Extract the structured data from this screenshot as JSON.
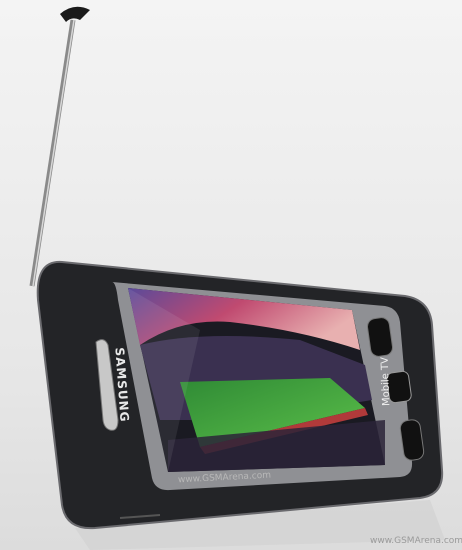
{
  "photo": {
    "subject": "phone",
    "brand_text": "SAMSUNG",
    "screen_label": "Mobile TV",
    "screen_watermark": "www.GSMArena.com",
    "corner_watermark": "www.GSMArena.com",
    "colors": {
      "background": "#ececec",
      "body": "#2a2b2e",
      "bezel": "#9a9b9e",
      "pitch": "#3a9a3a",
      "sky": "#b0507a"
    }
  }
}
